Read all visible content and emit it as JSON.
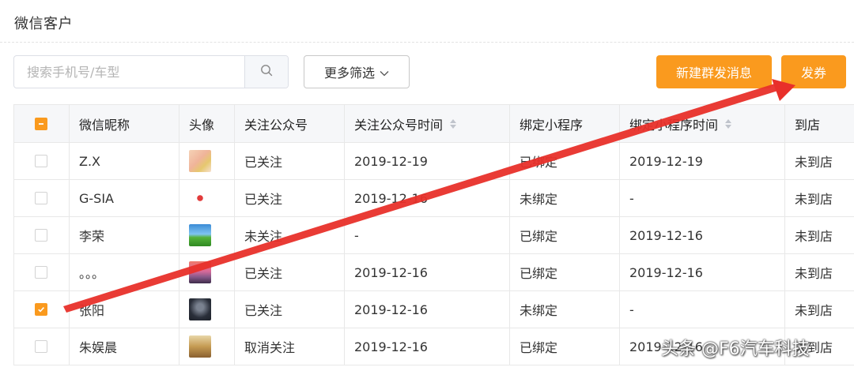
{
  "page": {
    "title": "微信客户"
  },
  "toolbar": {
    "search_placeholder": "搜索手机号/车型",
    "filter_label": "更多筛选",
    "mass_message_label": "新建群发消息",
    "coupon_label": "发券"
  },
  "colors": {
    "accent": "#fa9a1e",
    "arrow": "#e8302a"
  },
  "table": {
    "columns": [
      "微信昵称",
      "头像",
      "关注公众号",
      "关注公众号时间",
      "绑定小程序",
      "绑定小程序时间",
      "到店"
    ],
    "rows": [
      {
        "nickname": "Z.X",
        "avatar_icon": "avatar-anime-girl",
        "follow": "已关注",
        "follow_time": "2019-12-19",
        "bind": "已绑定",
        "bind_time": "2019-12-19",
        "visit": "未到店",
        "checked": false
      },
      {
        "nickname": "G-SIA",
        "avatar_icon": "avatar-red-logo",
        "follow": "已关注",
        "follow_time": "2019-12-16",
        "bind": "未绑定",
        "bind_time": "-",
        "visit": "未到店",
        "checked": false
      },
      {
        "nickname": "李荣",
        "avatar_icon": "avatar-landscape",
        "follow": "未关注",
        "follow_time": "-",
        "bind": "已绑定",
        "bind_time": "2019-12-16",
        "visit": "未到店",
        "checked": false
      },
      {
        "nickname": "。。。",
        "avatar_icon": "avatar-sunset",
        "follow": "已关注",
        "follow_time": "2019-12-16",
        "bind": "已绑定",
        "bind_time": "2019-12-16",
        "visit": "未到店",
        "checked": false
      },
      {
        "nickname": "张阳",
        "avatar_icon": "avatar-dark",
        "follow": "已关注",
        "follow_time": "2019-12-16",
        "bind": "未绑定",
        "bind_time": "-",
        "visit": "未到店",
        "checked": true
      },
      {
        "nickname": "朱娱晨",
        "avatar_icon": "avatar-portrait",
        "follow": "取消关注",
        "follow_time": "2019-12-16",
        "bind": "已绑定",
        "bind_time": "2019-12-16",
        "visit": "未到店",
        "checked": false
      }
    ]
  },
  "watermark": "头条 @F6汽车科技"
}
